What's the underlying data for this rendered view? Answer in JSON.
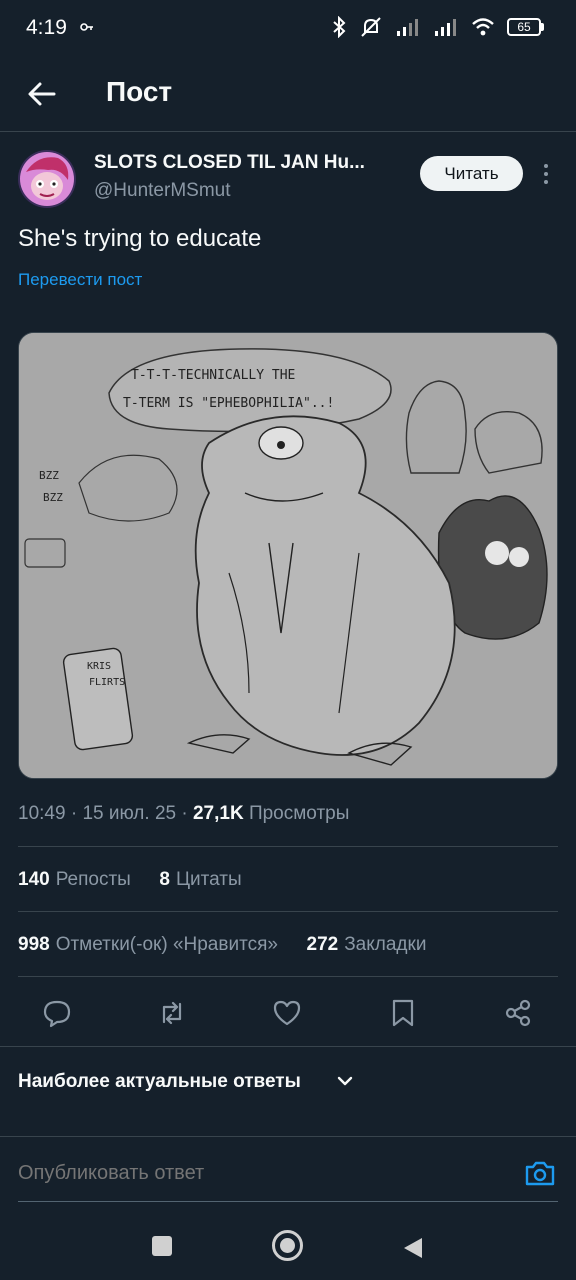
{
  "status_bar": {
    "time": "4:19",
    "battery": "65"
  },
  "header": {
    "title": "Пост"
  },
  "author": {
    "display_name": "SLOTS CLOSED TIL JAN Hu...",
    "handle": "@HunterMSmut",
    "follow_label": "Читать"
  },
  "post": {
    "text": "She's trying to educate",
    "translate_label": "Перевести пост",
    "image_caption_text": [
      "T-T-T-TECHNICALLY THE",
      "T-TERM IS \"EPHEBOPHILIA\"..!",
      "BZZ",
      "BZZ",
      "KRIS",
      "FLIRTS"
    ],
    "time": "10:49",
    "date": "15 июл. 25",
    "views_count": "27,1K",
    "views_label": "Просмотры"
  },
  "stats": {
    "reposts_count": "140",
    "reposts_label": "Репосты",
    "quotes_count": "8",
    "quotes_label": "Цитаты",
    "likes_count": "998",
    "likes_label": "Отметки(-ок) «Нравится»",
    "bookmarks_count": "272",
    "bookmarks_label": "Закладки"
  },
  "replies": {
    "sort_label": "Наиболее актуальные ответы"
  },
  "composer": {
    "placeholder": "Опубликовать ответ"
  },
  "colors": {
    "background": "#15202b",
    "accent": "#1d9bf0",
    "muted": "#8b98a5"
  }
}
